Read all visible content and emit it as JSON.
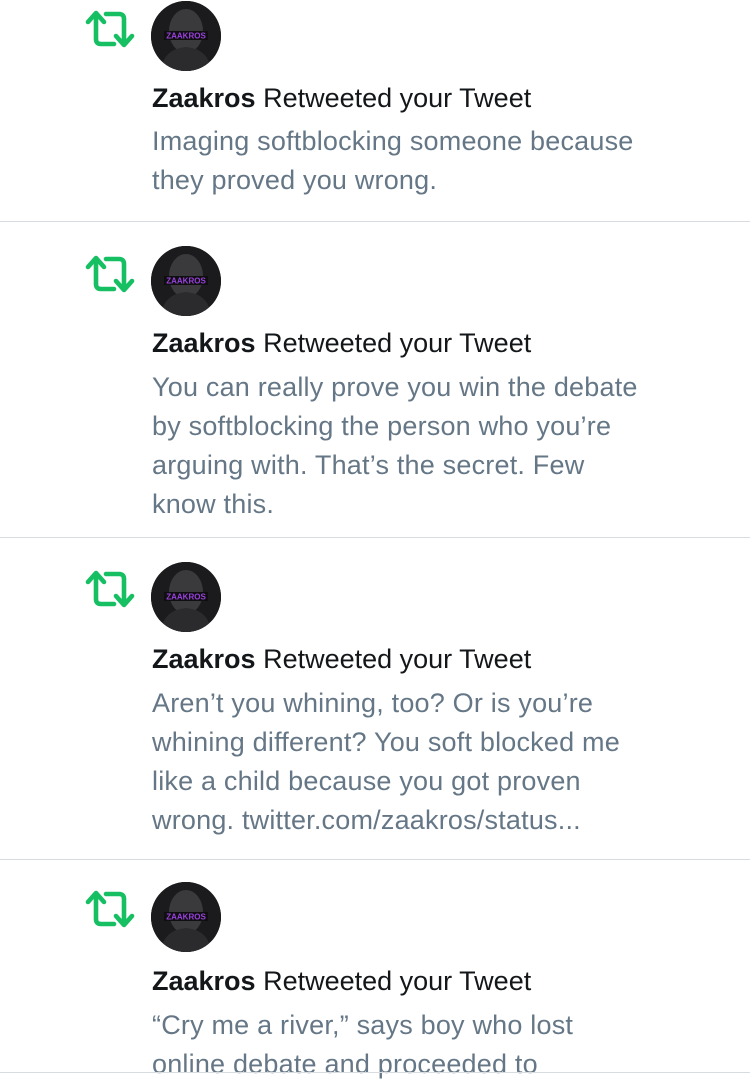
{
  "colors": {
    "retweet_green": "#17bf63",
    "name_text": "#14171a",
    "tweet_text": "#657786",
    "divider": "#d8dce0",
    "avatar_bg": "#1b1b1d",
    "avatar_logo": "#9b40e0"
  },
  "icons": {
    "retweet": "retweet-icon",
    "avatar": "avatar-image"
  },
  "notifications": [
    {
      "username": "Zaakros",
      "action": " Retweeted your Tweet",
      "avatar_label": "ZAAKROS",
      "lines": [
        "Imaging softblocking someone because",
        "they proved you wrong."
      ]
    },
    {
      "username": "Zaakros",
      "action": " Retweeted your Tweet",
      "avatar_label": "ZAAKROS",
      "lines": [
        "You can really prove you win the debate",
        "by softblocking the person who you’re",
        "arguing with. That’s the secret. Few",
        "know this."
      ]
    },
    {
      "username": "Zaakros",
      "action": " Retweeted your Tweet",
      "avatar_label": "ZAAKROS",
      "lines": [
        "Aren’t you whining, too? Or is you’re",
        "whining different? You soft blocked me",
        "like a child because you got proven",
        "wrong. twitter.com/zaakros/status..."
      ]
    },
    {
      "username": "Zaakros",
      "action": " Retweeted your Tweet",
      "avatar_label": "ZAAKROS",
      "lines": [
        "“Cry me a river,” says boy who lost",
        "online debate and proceeded to"
      ]
    }
  ]
}
